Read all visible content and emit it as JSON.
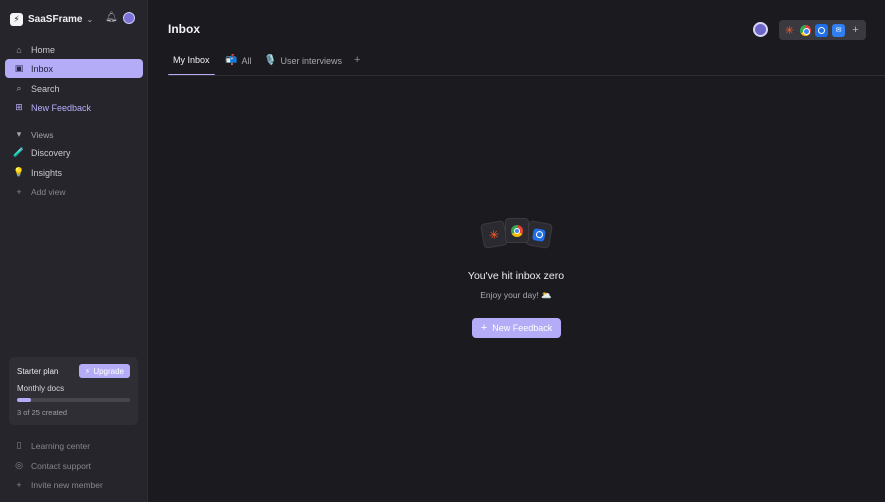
{
  "workspace": {
    "name": "SaaSFrame",
    "logo_glyph": "⚡"
  },
  "sidebar": {
    "items": [
      {
        "label": "Home",
        "icon": "home-icon"
      },
      {
        "label": "Inbox",
        "icon": "inbox-icon"
      },
      {
        "label": "Search",
        "icon": "search-icon"
      },
      {
        "label": "New Feedback",
        "icon": "plus-icon"
      }
    ],
    "views": {
      "label": "Views",
      "items": [
        {
          "label": "Discovery",
          "emoji": "🧪"
        },
        {
          "label": "Insights",
          "emoji": "💡"
        }
      ],
      "add_label": "Add view"
    },
    "plan": {
      "title": "Starter plan",
      "upgrade_label": "Upgrade",
      "docs_label": "Monthly docs",
      "progress_fraction": 0.12,
      "count_text": "3 of 25 created"
    },
    "footer": [
      {
        "label": "Learning center",
        "icon": "book-icon"
      },
      {
        "label": "Contact support",
        "icon": "support-icon"
      },
      {
        "label": "Invite new member",
        "icon": "plus-icon"
      }
    ]
  },
  "header": {
    "title": "Inbox"
  },
  "tabs": [
    {
      "label": "My Inbox",
      "emoji": ""
    },
    {
      "label": "All",
      "emoji": "📬"
    },
    {
      "label": "User interviews",
      "emoji": "🎙️"
    }
  ],
  "empty_state": {
    "title": "You've hit inbox zero",
    "subtitle": "Enjoy your day! 🌥️",
    "cta_label": "New Feedback"
  },
  "colors": {
    "accent": "#b4acf7",
    "background": "#1b1a1f",
    "sidebar": "#26252b"
  }
}
